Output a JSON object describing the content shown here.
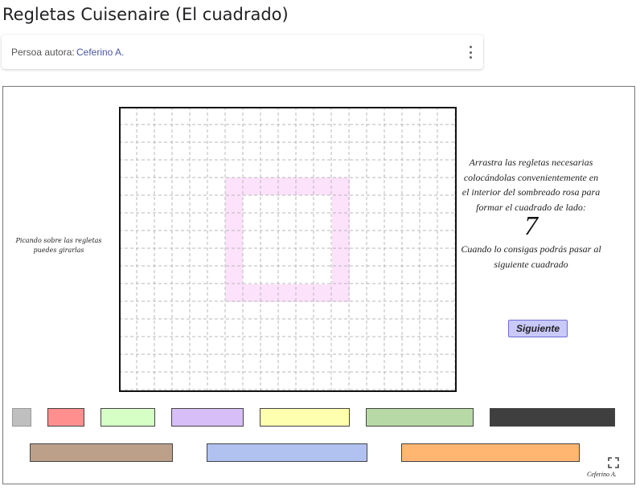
{
  "page": {
    "title": "Regletas Cuisenaire (El cuadrado)"
  },
  "author_card": {
    "label": "Persoa autora:",
    "name": "Ceferino A.",
    "menu_icon": "more-vertical-icon"
  },
  "applet": {
    "hint_left": "Picando sobre las regletas puedes girarlas",
    "instructions": "Arrastra las regletas necesarias colocándolas convenientemente en el interior del sombreado rosa para formar el cuadrado de lado:",
    "side_length": "7",
    "instructions_2": "Cuando lo consigas podrás pasar al siguiente cuadrado",
    "next_button": "Siguiente",
    "credit": "Ceferino A.",
    "fullscreen_icon": "fullscreen-icon",
    "colors": {
      "target_shade": "#fde2fb",
      "button_fill": "#c9c9fa",
      "grid_line": "#b8b8b8",
      "grid_border": "#111111"
    },
    "rods": [
      {
        "length": 1,
        "color": "#bfbfbf"
      },
      {
        "length": 2,
        "color": "#ff8f8f"
      },
      {
        "length": 3,
        "color": "#d6ffc6"
      },
      {
        "length": 4,
        "color": "#d7bef8"
      },
      {
        "length": 5,
        "color": "#ffffb0"
      },
      {
        "length": 6,
        "color": "#b7d9a5"
      },
      {
        "length": 7,
        "color": "#3f3f3f"
      },
      {
        "length": 8,
        "color": "#bca08a"
      },
      {
        "length": 9,
        "color": "#b1c1f0"
      },
      {
        "length": 10,
        "color": "#ffb670"
      }
    ]
  }
}
